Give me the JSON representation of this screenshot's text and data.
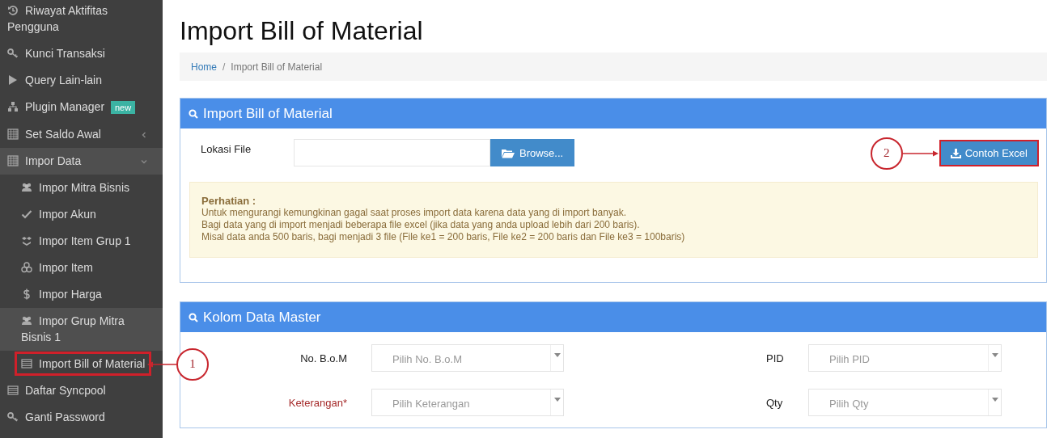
{
  "sidebar": {
    "items": [
      {
        "label": "Riwayat Aktifitas Pengguna",
        "kind": "link",
        "highlighted": false
      },
      {
        "label": "Kunci Transaksi",
        "kind": "link",
        "highlighted": false
      },
      {
        "label": "Query Lain-lain",
        "kind": "link",
        "highlighted": false
      },
      {
        "label": "Plugin Manager",
        "kind": "link",
        "highlighted": false,
        "badge": "new"
      },
      {
        "label": "Set Saldo Awal",
        "kind": "menu",
        "expanded": false,
        "highlighted": false
      },
      {
        "label": "Impor Data",
        "kind": "menu",
        "expanded": true,
        "highlighted": true,
        "children": [
          {
            "label": "Impor Mitra Bisnis",
            "highlighted": false
          },
          {
            "label": "Impor Akun",
            "highlighted": false
          },
          {
            "label": "Impor Item Grup 1",
            "highlighted": false
          },
          {
            "label": "Impor Item",
            "highlighted": false
          },
          {
            "label": "Impor Harga",
            "highlighted": false
          },
          {
            "label": "Impor Grup Mitra Bisnis 1",
            "highlighted": true
          },
          {
            "label": "Import Bill of Material",
            "highlighted": false,
            "callout": "1"
          }
        ]
      },
      {
        "label": "Daftar Syncpool",
        "kind": "link",
        "highlighted": false
      },
      {
        "label": "Ganti Password",
        "kind": "link",
        "highlighted": false
      }
    ]
  },
  "page": {
    "title": "Import Bill of Material"
  },
  "breadcrumb_separator": "/",
  "breadcrumb": [
    {
      "label": "Home",
      "kind": "link"
    },
    {
      "label": "Import Bill of Material",
      "kind": "current"
    }
  ],
  "import_panel": {
    "title": "Import Bill of Material",
    "file_label": "Lokasi File",
    "browse_button": "Browse...",
    "sample_button": {
      "label": "Contoh Excel",
      "callout": "2"
    },
    "notice": {
      "title": "Perhatian :",
      "lines": [
        "Untuk mengurangi kemungkinan gagal saat proses import data karena data yang di import banyak.",
        "Bagi data yang di import menjadi beberapa file excel (jika data yang anda upload lebih dari 200 baris).",
        "Misal data anda 500 baris, bagi menjadi 3 file (File ke1 = 200 baris, File ke2 = 200 baris dan File ke3 = 100baris)"
      ]
    }
  },
  "master_panel": {
    "title": "Kolom Data Master",
    "fields": [
      {
        "label": "No. B.o.M",
        "placeholder": "Pilih No. B.o.M",
        "required": false
      },
      {
        "label": "PID",
        "placeholder": "Pilih PID",
        "required": false
      },
      {
        "label": "Keterangan*",
        "placeholder": "Pilih Keterangan",
        "required": true
      },
      {
        "label": "Qty",
        "placeholder": "Pilih Qty",
        "required": false
      }
    ]
  }
}
